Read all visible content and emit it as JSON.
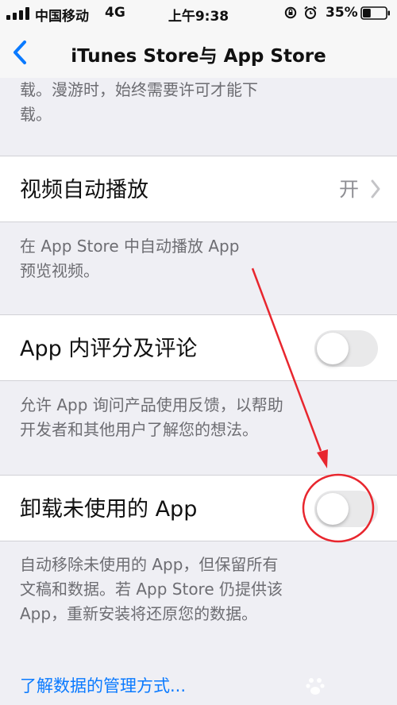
{
  "status_bar": {
    "carrier": "中国移动",
    "network": "4G",
    "time": "上午9:38",
    "battery_percent": "35%",
    "signal_bars": 4,
    "battery_level": 0.35,
    "icons": [
      "signal-icon",
      "orientation-lock-icon",
      "alarm-icon",
      "battery-icon"
    ]
  },
  "nav": {
    "title": "iTunes Store与 App Store",
    "back_icon": "chevron-left-icon"
  },
  "sections": {
    "top_footer": [
      "载。漫游时，始终需要许可才能下",
      "载。"
    ],
    "video_autoplay": {
      "label": "视频自动播放",
      "value": "开",
      "footer": [
        "在 App Store 中自动播放 App",
        "预览视频。"
      ]
    },
    "in_app_ratings": {
      "label": "App 内评分及评论",
      "on": false,
      "footer": [
        "允许 App 询问产品使用反馈，以帮助",
        "开发者和其他用户了解您的想法。"
      ]
    },
    "offload_apps": {
      "label": "卸载未使用的 App",
      "on": false,
      "footer": [
        "自动移除未使用的 App，但保留所有",
        "文稿和数据。若 App Store 仍提供该",
        "App，重新安装将还原您的数据。"
      ]
    },
    "data_link": "了解数据的管理方式..."
  },
  "colors": {
    "background": "#efeff4",
    "accent": "#0a7aff",
    "annotation_red": "#e8262e",
    "toggle_off": "#e9e9ea"
  }
}
